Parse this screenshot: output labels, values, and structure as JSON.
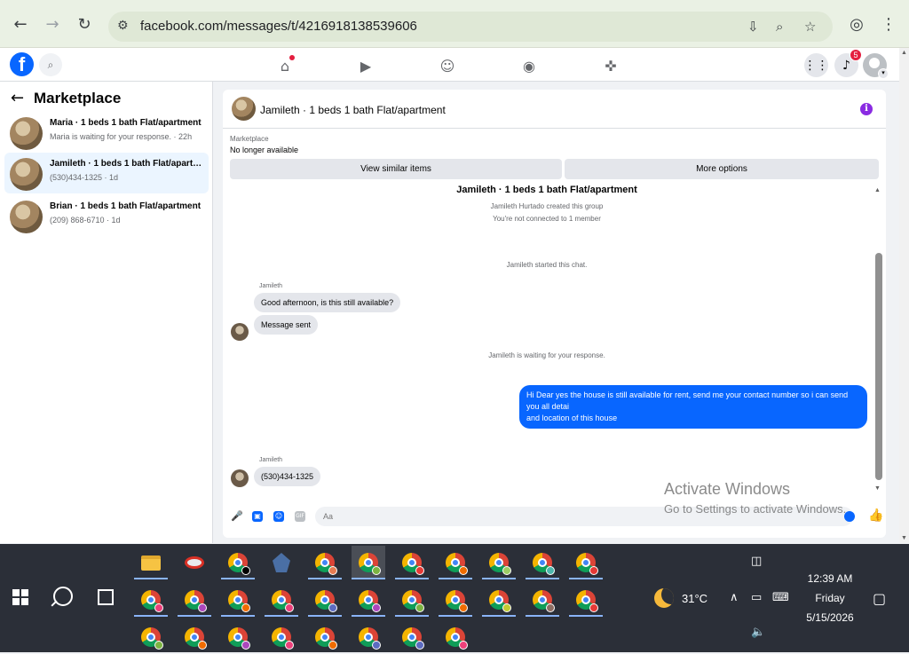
{
  "browser": {
    "url": "facebook.com/messages/t/4216918138539606"
  },
  "fb": {
    "notification_count": "5"
  },
  "sidebar": {
    "title": "Marketplace",
    "conversations": [
      {
        "name": "Maria · 1 beds 1 bath Flat/apartment",
        "sub": "Maria is waiting for your response. · 22h"
      },
      {
        "name": "Jamileth · 1 beds 1 bath Flat/apartment",
        "sub": "(530)434-1325 · 1d"
      },
      {
        "name": "Brian · 1 beds 1 bath Flat/apartment",
        "sub": "(209) 868-6710 · 1d"
      }
    ]
  },
  "chat": {
    "title": "Jamileth · 1 beds 1 bath Flat/apartment",
    "marketplace_label": "Marketplace",
    "listing_status": "No longer available",
    "view_similar": "View similar items",
    "more_options": "More options",
    "group_title": "Jamileth · 1 beds 1 bath Flat/apartment",
    "system": {
      "created": "Jamileth Hurtado created this group",
      "not_connected": "You're not connected to 1 member",
      "started": "Jamileth started this chat.",
      "waiting": "Jamileth is waiting for your response."
    },
    "sender_name": "Jamileth",
    "messages": {
      "in1": "Good afternoon, is this still available?",
      "in2": "Message sent",
      "out1": "Hi Dear yes the house is still available for rent, send me your contact number so i can send you all detai",
      "out1b": "and location of this house",
      "in3": "(530)434-1325"
    },
    "composer_placeholder": "Aa"
  },
  "watermark": {
    "line1": "Activate Windows",
    "line2": "Go to Settings to activate Windows."
  },
  "taskbar": {
    "temperature": "31°C",
    "time": "12:39 AM",
    "day": "Friday",
    "date": "5/15/2026"
  },
  "colors": {
    "fb_blue": "#0866ff",
    "taskbar_bg": "#2b2f38",
    "browser_bg": "#eaf1e4"
  }
}
